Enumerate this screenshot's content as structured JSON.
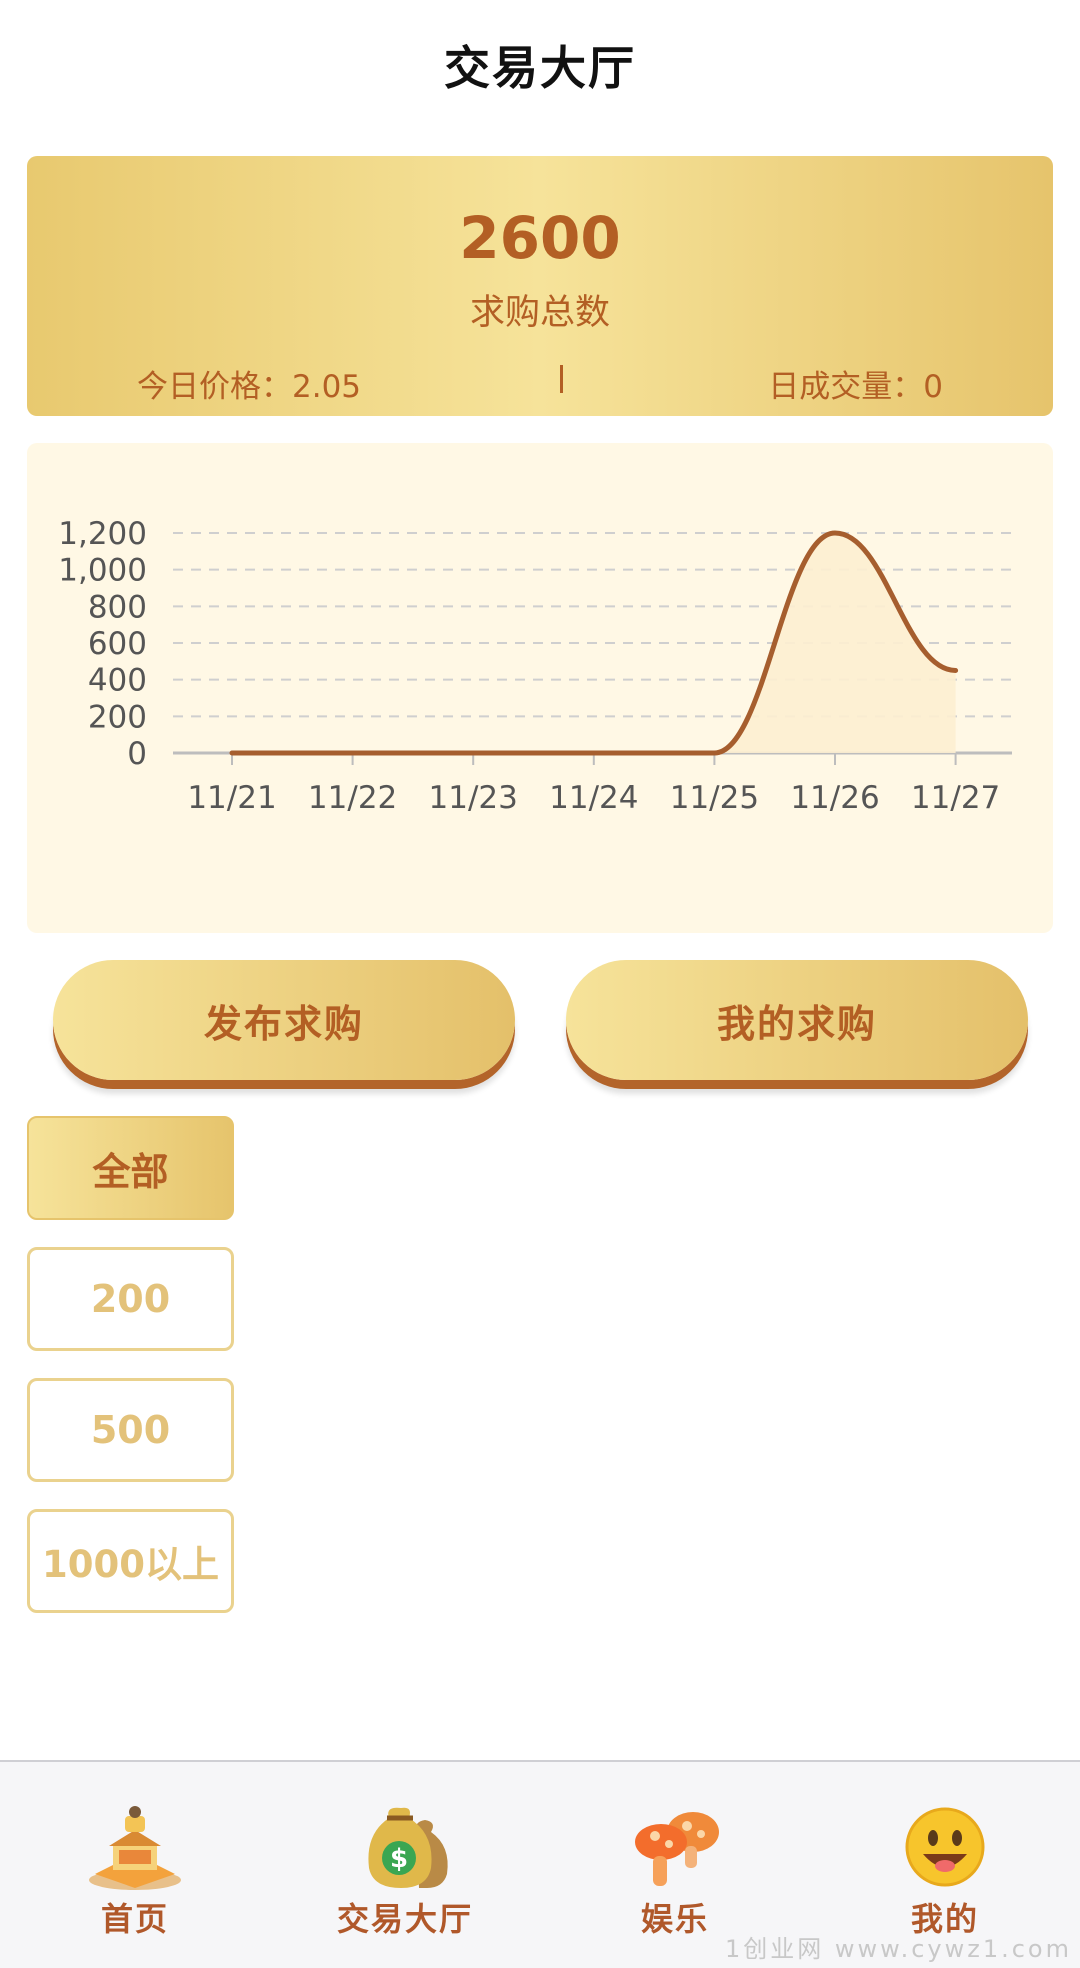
{
  "header": {
    "title": "交易大厅"
  },
  "summary": {
    "total": "2600",
    "total_label": "求购总数",
    "price_text": "今日价格：2.05",
    "volume_text": "日成交量：0"
  },
  "chart_data": {
    "type": "area",
    "categories": [
      "11/21",
      "11/22",
      "11/23",
      "11/24",
      "11/25",
      "11/26",
      "11/27"
    ],
    "values": [
      0,
      0,
      0,
      0,
      0,
      1200,
      450
    ],
    "yticks": [
      "0",
      "200",
      "400",
      "600",
      "800",
      "1,000",
      "1,200"
    ],
    "ylim": [
      0,
      1200
    ],
    "smooth": true,
    "grid": true,
    "line_color": "#a65e2e",
    "fill_color": "#fdeed0"
  },
  "actions": {
    "publish_label": "发布求购",
    "mine_label": "我的求购"
  },
  "filters": [
    {
      "label": "全部",
      "active": true
    },
    {
      "label": "200",
      "active": false
    },
    {
      "label": "500",
      "active": false
    },
    {
      "label": "1000以上",
      "active": false
    }
  ],
  "tabbar": [
    {
      "label": "首页",
      "icon": "temple-icon"
    },
    {
      "label": "交易大厅",
      "icon": "money-bag-icon"
    },
    {
      "label": "娱乐",
      "icon": "mushroom-icon"
    },
    {
      "label": "我的",
      "icon": "smiley-face-icon"
    }
  ],
  "watermark": "1创业网 www.cywz1.com",
  "colors": {
    "accent": "#b35f24",
    "gold_light": "#f6e39a",
    "gold_dark": "#e6c46c",
    "chart_bg": "#fff8e5"
  }
}
